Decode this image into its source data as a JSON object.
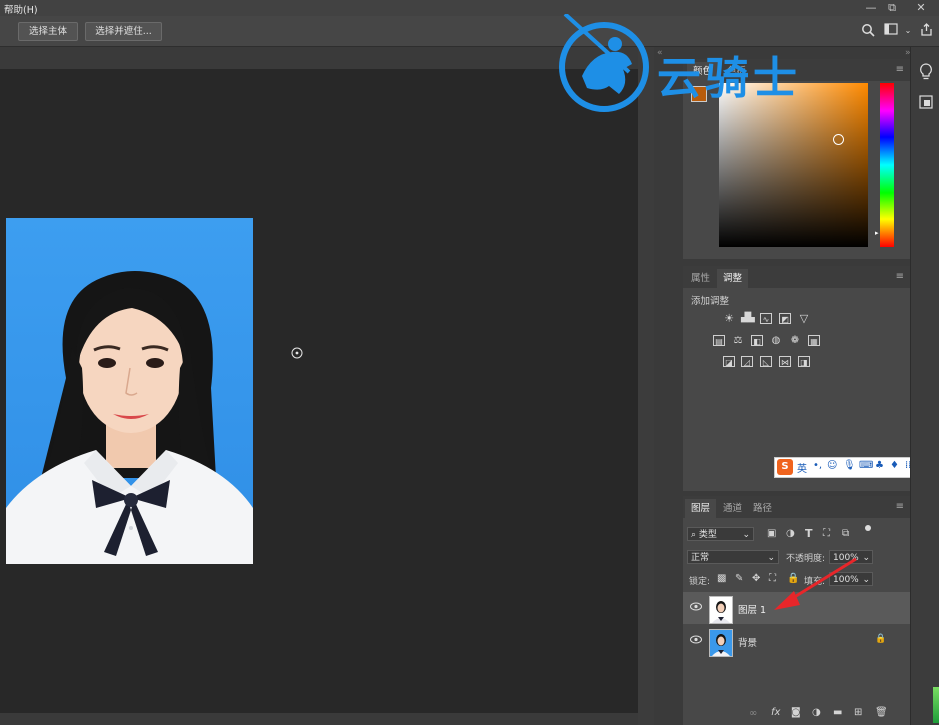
{
  "menubar": {
    "help_menu": "帮助(H)",
    "minimize": "—",
    "restore": "⧉",
    "close": "✕"
  },
  "options": {
    "select_subject": "选择主体",
    "select_mask": "选择并遮住..."
  },
  "watermark": {
    "text": "云骑士"
  },
  "color_panel": {
    "tab_color": "颜色",
    "tab_swatches": "色板",
    "fg_color": "#b85c0c",
    "bg_color": "#ffffff"
  },
  "adjust_panel": {
    "tab_properties": "属性",
    "tab_adjust": "调整",
    "add_adjust": "添加调整"
  },
  "layers_panel": {
    "tab_layers": "图层",
    "tab_channels": "通道",
    "tab_paths": "路径",
    "filter_kind": "类型",
    "blend_mode": "正常",
    "opacity_label": "不透明度:",
    "opacity_value": "100%",
    "lock_label": "锁定:",
    "fill_label": "填充:",
    "fill_value": "100%",
    "layers": [
      {
        "name": "图层 1",
        "selected": true
      },
      {
        "name": "背景",
        "selected": false
      }
    ]
  },
  "ime": {
    "lang": "英"
  },
  "colors": {
    "accent": "#1e8fe6",
    "arrow": "#e8262a",
    "panel_bg": "#484848"
  }
}
